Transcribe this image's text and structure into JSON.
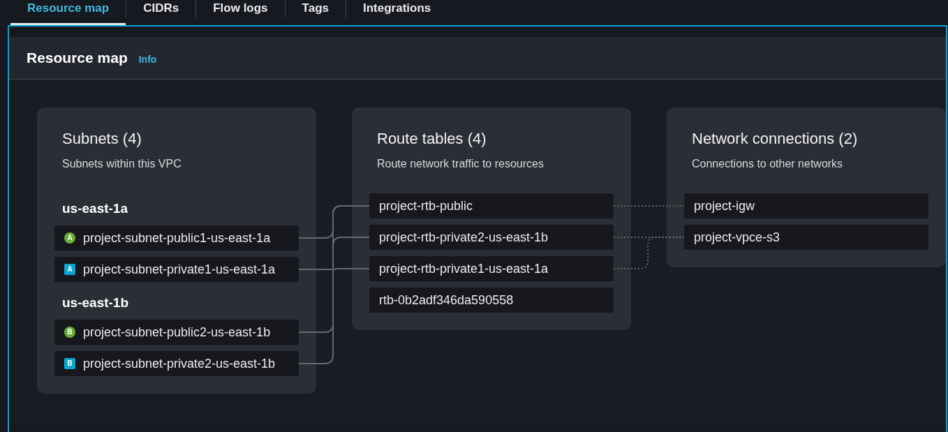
{
  "tabs": [
    {
      "label": "Resource map",
      "selected": true
    },
    {
      "label": "CIDRs",
      "selected": false
    },
    {
      "label": "Flow logs",
      "selected": false
    },
    {
      "label": "Tags",
      "selected": false
    },
    {
      "label": "Integrations",
      "selected": false
    }
  ],
  "resource_map": {
    "title": "Resource map",
    "info_link": "Info",
    "subnets": {
      "title": "Subnets (4)",
      "description": "Subnets within this VPC",
      "zones": [
        {
          "name": "us-east-1a",
          "subnets": [
            {
              "name": "project-subnet-public1-us-east-1a",
              "badge": "A",
              "kind": "public"
            },
            {
              "name": "project-subnet-private1-us-east-1a",
              "badge": "A",
              "kind": "private"
            }
          ]
        },
        {
          "name": "us-east-1b",
          "subnets": [
            {
              "name": "project-subnet-public2-us-east-1b",
              "badge": "B",
              "kind": "public"
            },
            {
              "name": "project-subnet-private2-us-east-1b",
              "badge": "B",
              "kind": "private"
            }
          ]
        }
      ]
    },
    "route_tables": {
      "title": "Route tables (4)",
      "description": "Route network traffic to resources",
      "items": [
        {
          "name": "project-rtb-public"
        },
        {
          "name": "project-rtb-private2-us-east-1b"
        },
        {
          "name": "project-rtb-private1-us-east-1a"
        },
        {
          "name": "rtb-0b2adf346da590558"
        }
      ]
    },
    "network_connections": {
      "title": "Network connections (2)",
      "description": "Connections to other networks",
      "items": [
        {
          "name": "project-igw"
        },
        {
          "name": "project-vpce-s3"
        }
      ]
    }
  }
}
